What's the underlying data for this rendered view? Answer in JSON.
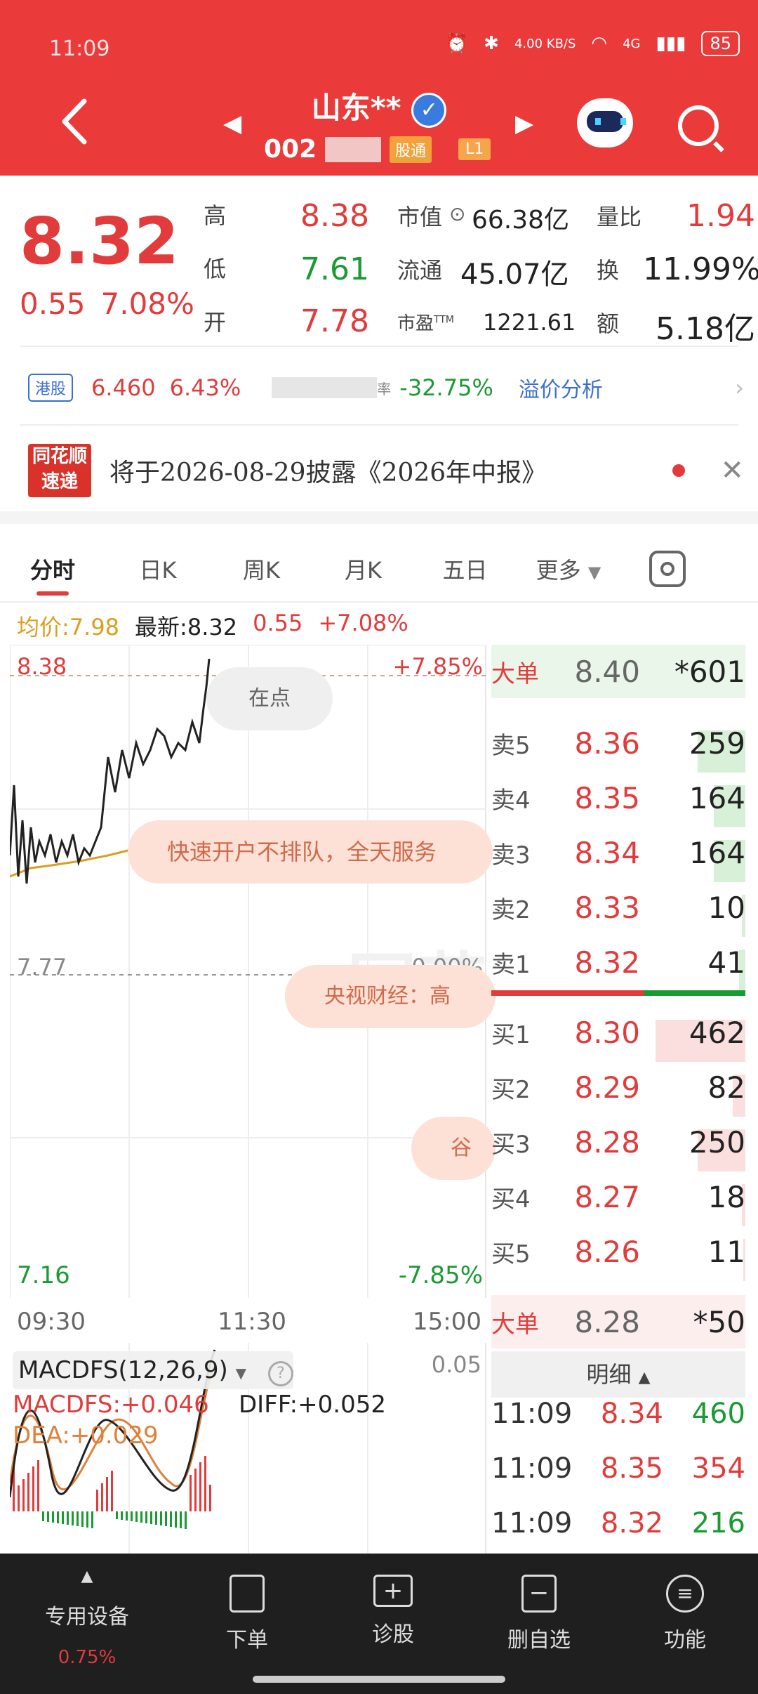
{
  "status_bar": {
    "time": "11:09",
    "net_speed": "4.00 KB/S",
    "signal": "4G",
    "battery": "85"
  },
  "header": {
    "title": "山东**",
    "code": "002",
    "tag_stock_connect": "股通",
    "tag_level": "L1"
  },
  "quote": {
    "price": "8.32",
    "change": "0.55",
    "change_pct": "7.08%",
    "rows": [
      {
        "l1": "高",
        "v1": "8.38",
        "l2": "市值",
        "v2": "66.38亿",
        "l3": "量比",
        "v3": "1.94"
      },
      {
        "l1": "低",
        "v1": "7.61",
        "l2": "流通",
        "v2": "45.07亿",
        "l3": "换",
        "v3": "11.99%"
      },
      {
        "l1": "开",
        "v1": "7.78",
        "l2": "市盈",
        "l2sup": "TTM",
        "v2": "1221.61",
        "l3": "额",
        "v3": "5.18亿"
      }
    ]
  },
  "hk": {
    "tag": "港股",
    "price": "6.460",
    "pct": "6.43%",
    "premium_label": "率",
    "premium": "-32.75%",
    "link": "溢价分析"
  },
  "news": {
    "logo_top": "同花顺",
    "logo_bottom": "速递",
    "text": "将于2026-08-29披露《2026年中报》"
  },
  "tabs": [
    "分时",
    "日K",
    "周K",
    "月K",
    "五日",
    "更多"
  ],
  "info": {
    "avg": "均价:7.98",
    "latest": "最新:8.32",
    "chg": "0.55",
    "pct": "+7.08%"
  },
  "chart": {
    "high": "8.38",
    "high_pct": "+7.85%",
    "prev": "7.77",
    "prev_pct": "0.00%",
    "low": "7.16",
    "low_pct": "-7.85%",
    "times": [
      "09:30",
      "11:30",
      "15:00"
    ],
    "bubble1": "在点",
    "bubble2": "快速开户不排队，全天服务",
    "bubble3": "央视财经：高",
    "bubble4": "谷"
  },
  "book": {
    "big_sell": {
      "label": "大单",
      "price": "8.40",
      "vol": "*601"
    },
    "sells": [
      {
        "label": "卖5",
        "price": "8.36",
        "vol": "259",
        "bar": 0.45
      },
      {
        "label": "卖4",
        "price": "8.35",
        "vol": "164",
        "bar": 0.3
      },
      {
        "label": "卖3",
        "price": "8.34",
        "vol": "164",
        "bar": 0.3
      },
      {
        "label": "卖2",
        "price": "8.33",
        "vol": "10",
        "bar": 0.03
      },
      {
        "label": "卖1",
        "price": "8.32",
        "vol": "41",
        "bar": 0.06
      }
    ],
    "buys": [
      {
        "label": "买1",
        "price": "8.30",
        "vol": "462",
        "bar": 0.85
      },
      {
        "label": "买2",
        "price": "8.29",
        "vol": "82",
        "bar": 0.12
      },
      {
        "label": "买3",
        "price": "8.28",
        "vol": "250",
        "bar": 0.45
      },
      {
        "label": "买4",
        "price": "8.27",
        "vol": "18",
        "bar": 0.03
      },
      {
        "label": "买5",
        "price": "8.26",
        "vol": "11",
        "bar": 0.02
      }
    ],
    "big_buy": {
      "label": "大单",
      "price": "8.28",
      "vol": "*50"
    }
  },
  "detail": {
    "header": "明细",
    "rows": [
      {
        "time": "11:09",
        "price": "8.34",
        "vol": "460"
      },
      {
        "time": "11:09",
        "price": "8.35",
        "vol": "354"
      },
      {
        "time": "11:09",
        "price": "8.32",
        "vol": "216"
      }
    ]
  },
  "macd": {
    "title": "MACDFS(12,26,9)",
    "val1": "MACDFS:+0.046",
    "diff": "DIFF:+0.052",
    "dea": "DEA:+0.029",
    "scale": "0.05"
  },
  "bottom_bar": {
    "items": [
      "专用设备",
      "下单",
      "诊股",
      "删自选",
      "功能"
    ],
    "pct": "0.75%"
  },
  "colors": {
    "red": "#e23b3b",
    "green": "#1a9a32",
    "header": "#ea3a3a",
    "avg_line": "#d9a020"
  }
}
